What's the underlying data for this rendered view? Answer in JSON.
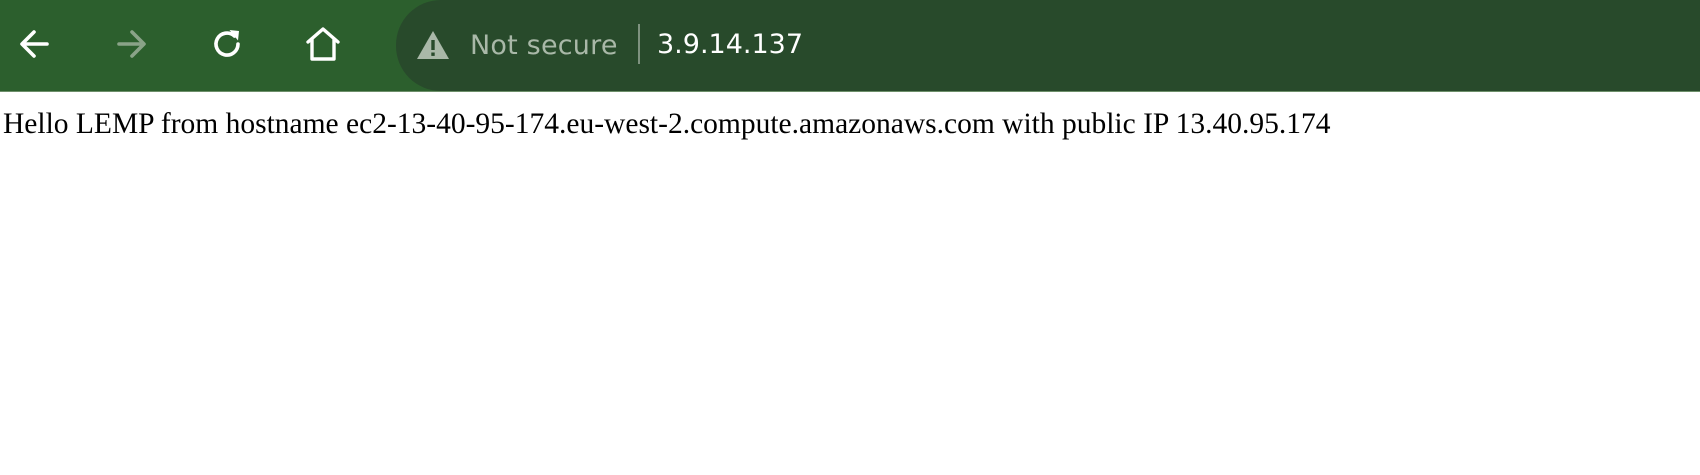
{
  "browser": {
    "toolbar": {
      "back_icon": "arrow-left-icon",
      "forward_icon": "arrow-right-icon",
      "forward_enabled": false,
      "reload_icon": "reload-icon",
      "home_icon": "home-icon"
    },
    "omnibox": {
      "security_icon": "warning-triangle-icon",
      "security_label": "Not secure",
      "url": "3.9.14.137"
    },
    "colors": {
      "toolbar_bg": "#2c5f2d",
      "omnibox_bg": "#284a2b",
      "security_text": "#a9b8a8"
    }
  },
  "page": {
    "body_text": "Hello LEMP from hostname ec2-13-40-95-174.eu-west-2.compute.amazonaws.com with public IP 13.40.95.174"
  }
}
